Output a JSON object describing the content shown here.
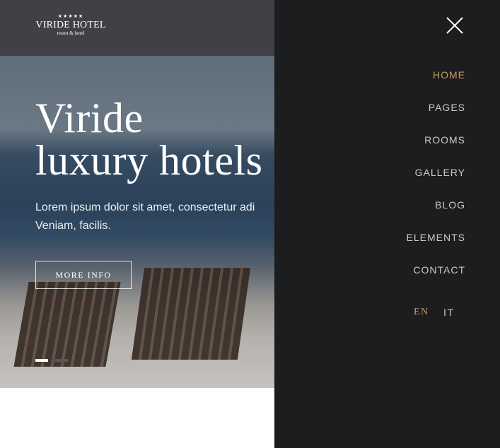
{
  "logo": {
    "stars": "★★★★★",
    "name": "VIRIDE HOTEL",
    "tagline": "resort & hotel"
  },
  "hero": {
    "title_line1": "Viride",
    "title_line2": "luxury hotels",
    "text_line1": "Lorem ipsum dolor sit amet, consectetur adi",
    "text_line2": "Veniam, facilis.",
    "button_label": "MORE INFO",
    "slides_total": 2,
    "slide_active": 1
  },
  "menu": {
    "close_icon": "close-icon",
    "items": [
      "HOME",
      "PAGES",
      "ROOMS",
      "GALLERY",
      "BLOG",
      "ELEMENTS",
      "CONTACT"
    ],
    "active_item": "HOME",
    "languages": [
      "EN",
      "IT"
    ],
    "active_language": "EN"
  },
  "colors": {
    "accent": "#c79a61",
    "panel_bg": "#1c1d1f",
    "header_bg": "#3f4145",
    "menu_text": "#c9c9c9"
  }
}
